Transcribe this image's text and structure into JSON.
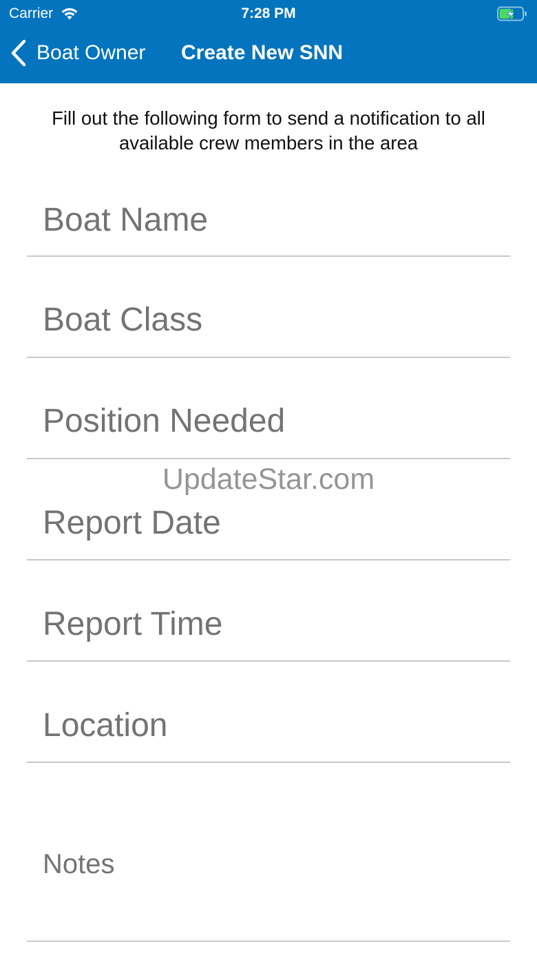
{
  "status_bar": {
    "carrier": "Carrier",
    "time": "7:28 PM",
    "wifi_icon": "wifi-icon",
    "battery_icon": "battery-charging-icon"
  },
  "nav": {
    "back_label": "Boat Owner",
    "back_icon": "chevron-left-icon",
    "title": "Create New SNN"
  },
  "colors": {
    "header_bg": "#0474be",
    "divider": "#c8c8c8",
    "placeholder": "#737373",
    "battery_fill": "#4cd964"
  },
  "intro_text": "Fill out the following form to send a notification to all available crew members in the area",
  "form": {
    "boat_name": {
      "value": "",
      "placeholder": "Boat Name"
    },
    "boat_class": {
      "value": "",
      "placeholder": "Boat Class"
    },
    "position_needed": {
      "value": "",
      "placeholder": "Position Needed"
    },
    "report_date": {
      "value": "",
      "placeholder": "Report Date"
    },
    "report_time": {
      "value": "",
      "placeholder": "Report Time"
    },
    "location": {
      "value": "",
      "placeholder": "Location"
    },
    "notes": {
      "value": "",
      "placeholder": "Notes"
    }
  },
  "watermark": "UpdateStar.com"
}
